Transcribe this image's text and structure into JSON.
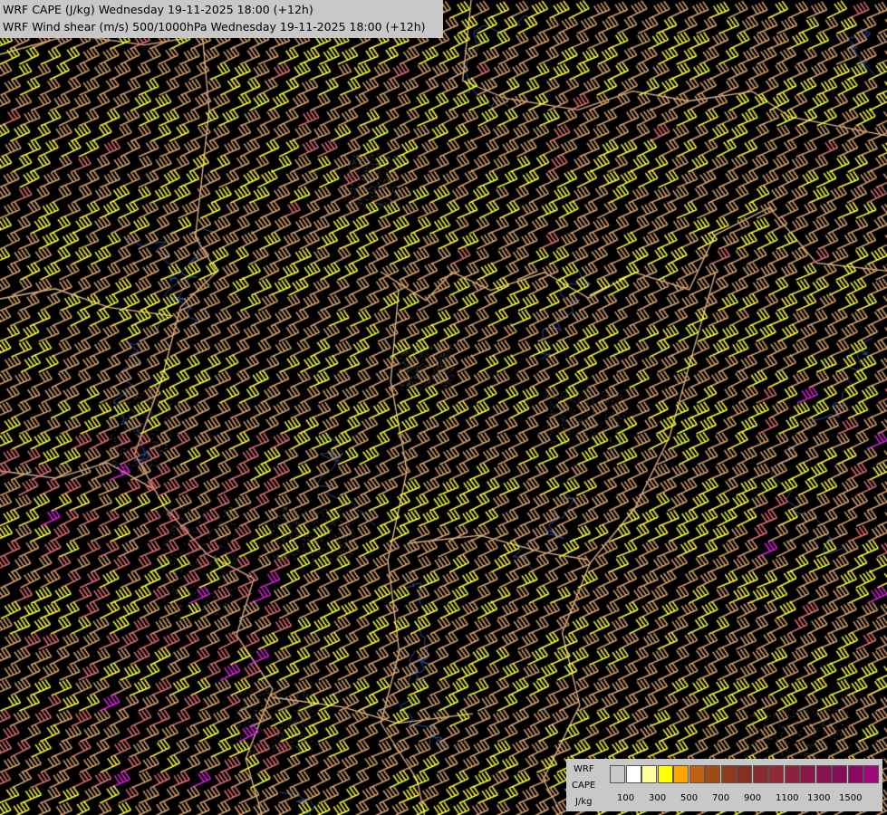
{
  "title": {
    "line1": "WRF CAPE (J/kg) Wednesday 19-11-2025 18:00 (+12h)",
    "line2": "WRF Wind shear (m/s) 500/1000hPa Wednesday 19-11-2025 18:00 (+12h)"
  },
  "legend": {
    "label_model": "WRF",
    "label_field": "CAPE",
    "label_unit": "J/kg",
    "swatches": [
      {
        "color": "#c8c8c8"
      },
      {
        "color": "#ffffff"
      },
      {
        "color": "#ffffa0"
      },
      {
        "color": "#ffff00"
      },
      {
        "color": "#ffa500"
      },
      {
        "color": "#c06010"
      },
      {
        "color": "#a04a18"
      },
      {
        "color": "#8e3a1c"
      },
      {
        "color": "#86301e"
      },
      {
        "color": "#8a2a30"
      },
      {
        "color": "#902838"
      },
      {
        "color": "#8e2040"
      },
      {
        "color": "#8a1848"
      },
      {
        "color": "#881250"
      },
      {
        "color": "#860c58"
      },
      {
        "color": "#8a0862"
      },
      {
        "color": "#a0087a"
      }
    ],
    "ticks": [
      "100",
      "300",
      "500",
      "700",
      "900",
      "1100",
      "1300",
      "1500"
    ]
  },
  "colors": {
    "background": "#000000",
    "barb_yellow": "#ffff33",
    "barb_tan": "#d8a46a",
    "barb_salmon": "#e07070",
    "barb_magenta": "#e020e0",
    "border": "#e0b890",
    "river": "#2a4a9a"
  }
}
